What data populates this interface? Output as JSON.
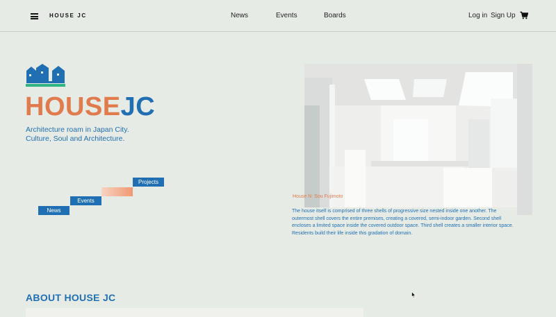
{
  "header": {
    "brand": "HOUSE JC",
    "nav": [
      "News",
      "Events",
      "Boards"
    ],
    "login": "Log in",
    "signup": "Sign Up"
  },
  "hero": {
    "title_part1": "HOUSE",
    "title_part2": "JC",
    "tagline_line1": "Architecture roam in Japan City.",
    "tagline_line2": "Culture, Soul and Architecture."
  },
  "stairs": {
    "projects": "Projects",
    "events": "Events",
    "news": "News"
  },
  "feature": {
    "caption": "House N: Sou Fujimoto",
    "description": "The house itself is comprised of three shells of progressive size nested inside one another. The outermost shell covers the entire premises, creating a covered, semi-indoor garden. Second shell encloses a limited space inside the covered outdoor space. Third shell creates a smaller interior space. Residents build their life inside this gradation of domain."
  },
  "about": {
    "title": "ABOUT HOUSE JC"
  },
  "colors": {
    "accent_blue": "#1f6fb2",
    "accent_orange": "#e07b4d",
    "background": "#e7ebe6"
  },
  "icons": {
    "menu": "hamburger-icon",
    "cart": "cart-icon",
    "logo": "houses-logo-icon"
  }
}
